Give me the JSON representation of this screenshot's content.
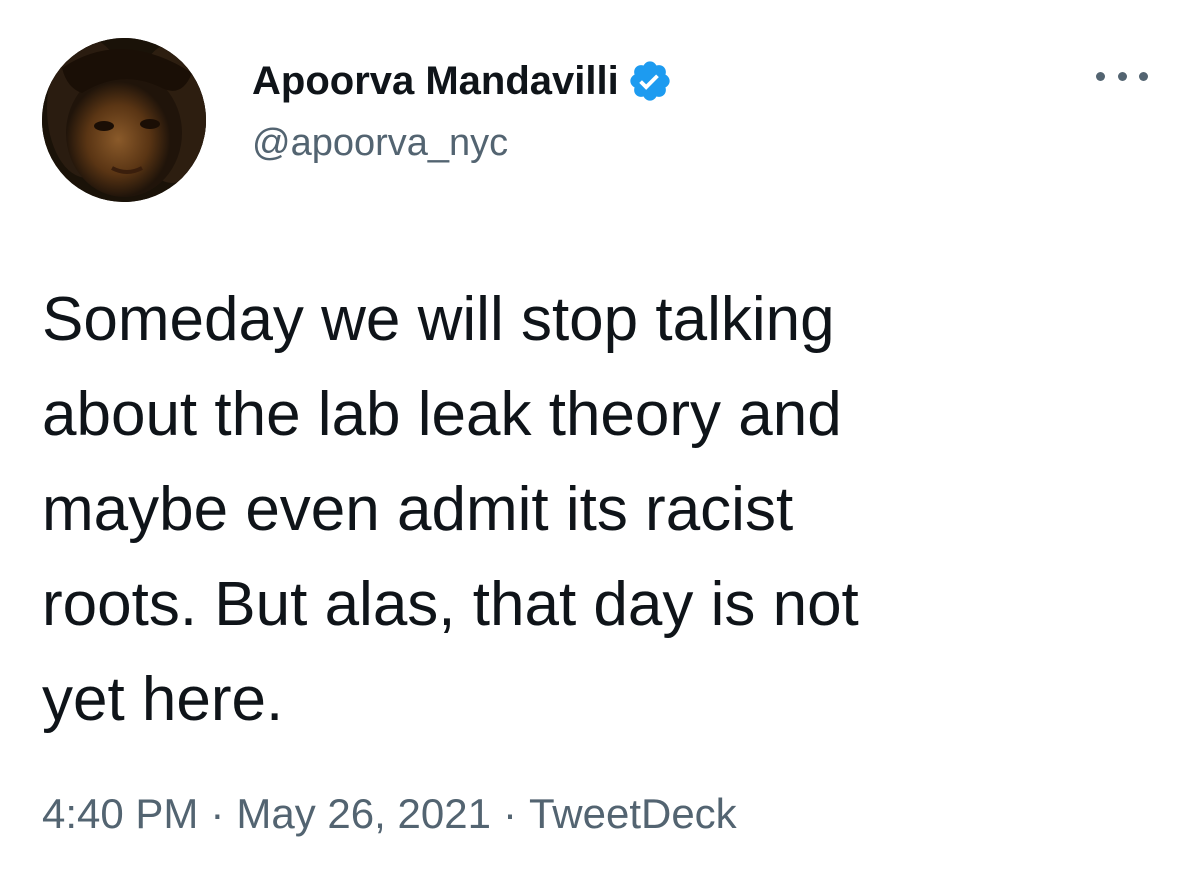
{
  "author": {
    "display_name": "Apoorva Mandavilli",
    "handle": "@apoorva_nyc",
    "verified": true,
    "avatar_icon": "user-avatar-photo"
  },
  "menu": {
    "icon": "more-options-icon"
  },
  "tweet": {
    "text": "Someday we will stop talking\nabout the lab leak theory and\nmaybe even admit its racist\nroots. But alas, that day is not\nyet here."
  },
  "meta": {
    "time": "4:40 PM",
    "separator": "·",
    "date": "May 26, 2021",
    "source": "TweetDeck"
  },
  "colors": {
    "primary_text": "#0f1419",
    "secondary_text": "#536471",
    "verified_blue": "#1d9bf0",
    "background": "#ffffff"
  }
}
